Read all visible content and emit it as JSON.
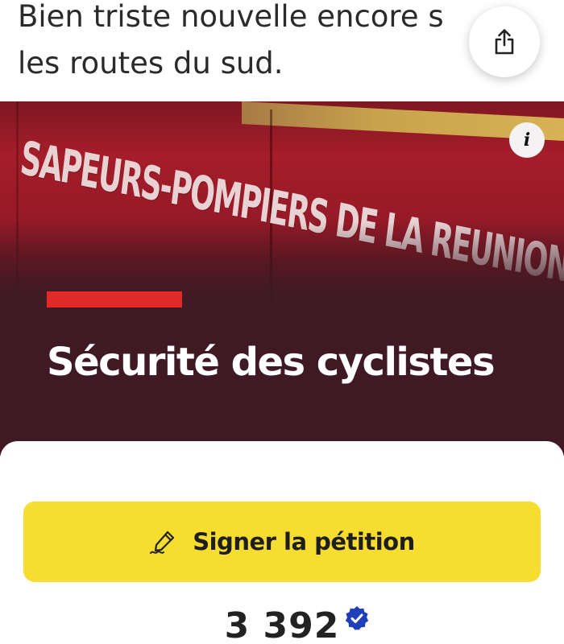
{
  "post": {
    "text_lines": [
      "Bien triste nouvelle encore s",
      "les routes du sud."
    ]
  },
  "hero": {
    "image_text": "SAPEURS-POMPIERS DE LA REUNION",
    "title": "Sécurité des cyclistes",
    "accent_color": "#e02a27",
    "background_color": "#3f1a24"
  },
  "actions": {
    "share_icon": "share-icon",
    "info_label": "i",
    "sign_label": "Signer la pétition",
    "sign_icon": "pen-signature-icon",
    "sign_color": "#f6dd2f"
  },
  "stats": {
    "signature_count": "3 392",
    "verified_icon": "verified-badge-icon",
    "verified_color": "#1f3fb8"
  }
}
